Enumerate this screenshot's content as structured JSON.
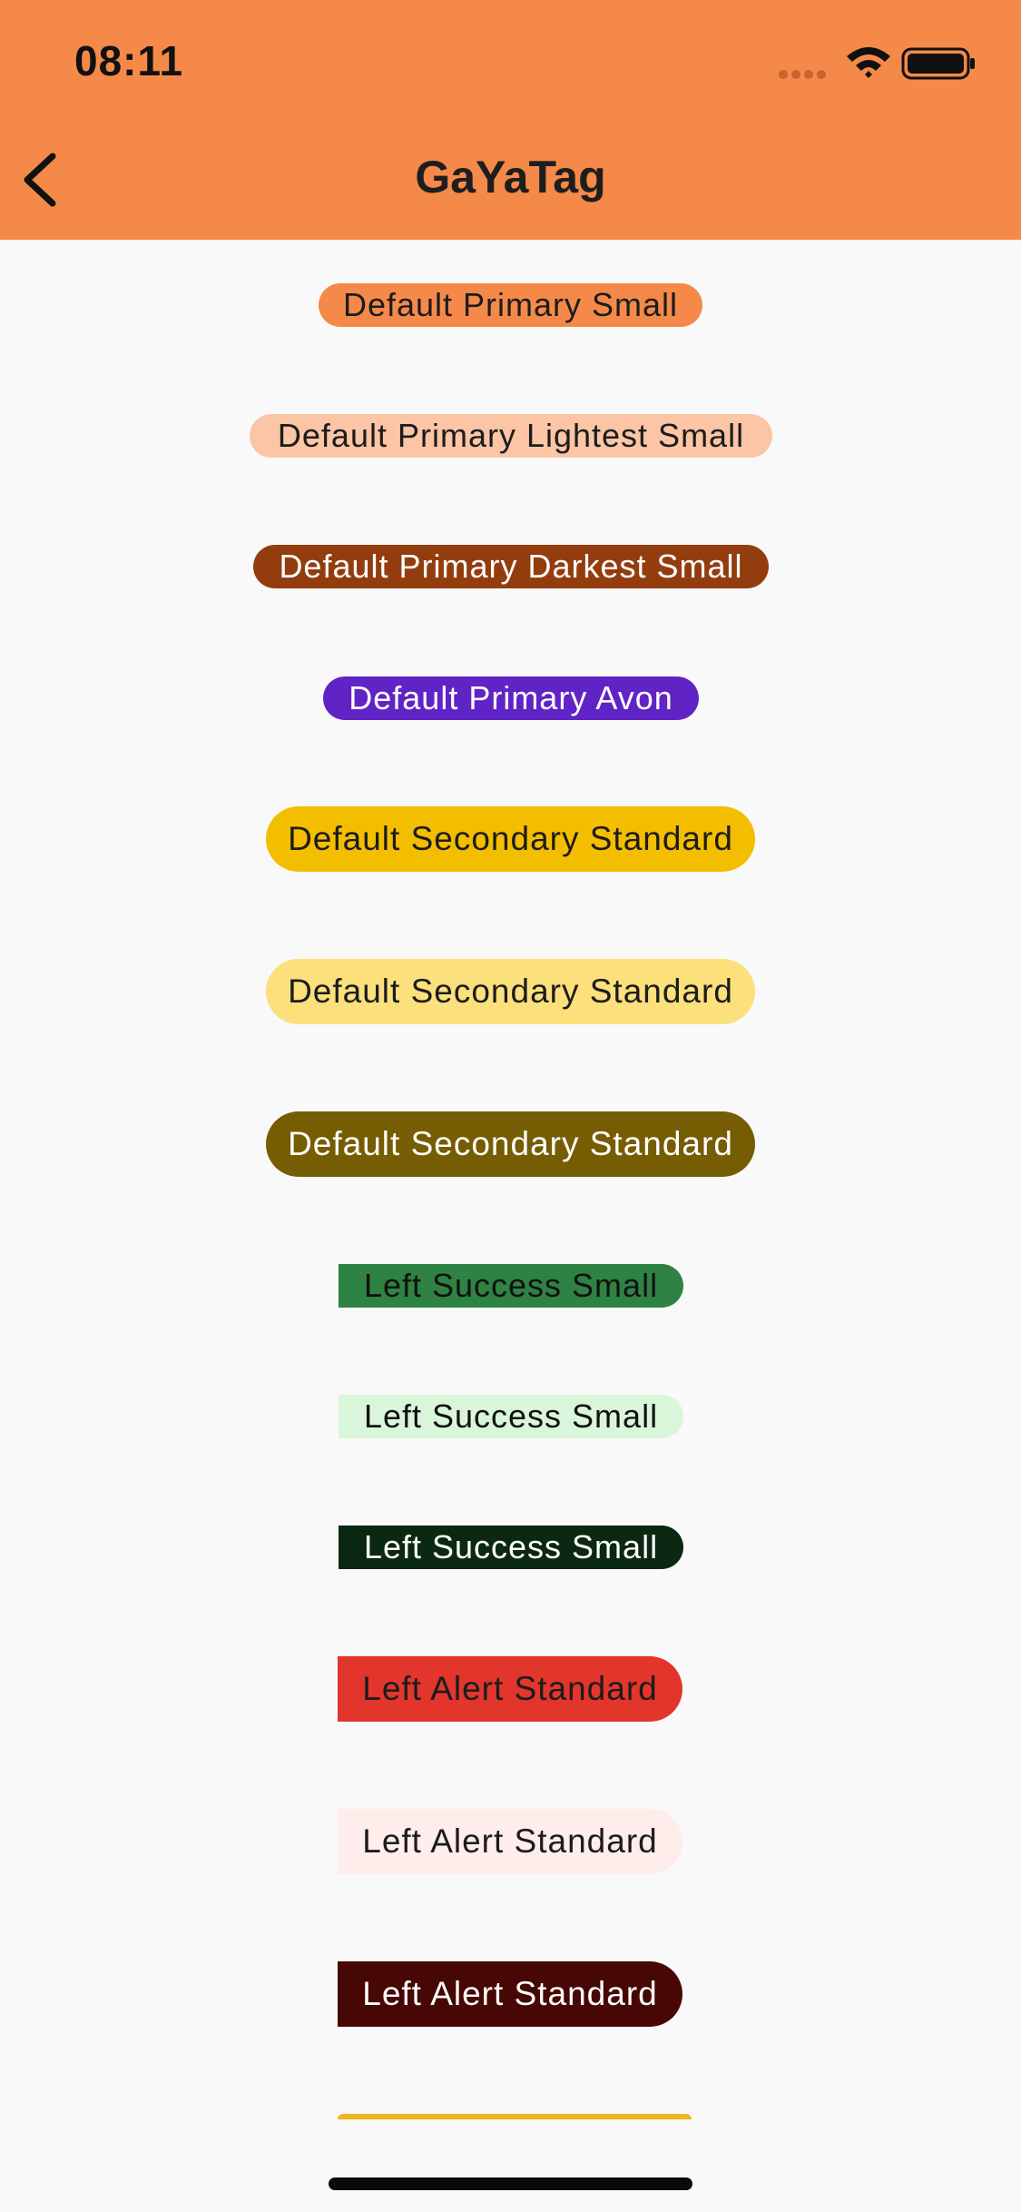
{
  "status_bar": {
    "time": "08:11"
  },
  "header": {
    "title": "GaYaTag",
    "back_icon": "chevron-left-icon"
  },
  "tags": [
    {
      "label": "Default Primary Small",
      "bg": "#F5894A",
      "fg": "#1C1C1C"
    },
    {
      "label": "Default Primary Lightest Small",
      "bg": "#FBC5A6",
      "fg": "#1C1C1C"
    },
    {
      "label": "Default Primary Darkest Small",
      "bg": "#933D0E",
      "fg": "#FFFFFF"
    },
    {
      "label": "Default Primary Avon",
      "bg": "#6023C5",
      "fg": "#FFFFFF"
    },
    {
      "label": "Default Secondary Standard",
      "bg": "#F4BE00",
      "fg": "#1C1C1C"
    },
    {
      "label": "Default Secondary Standard",
      "bg": "#FBE07C",
      "fg": "#1C1C1C"
    },
    {
      "label": "Default Secondary Standard",
      "bg": "#765C02",
      "fg": "#FFFFFF"
    },
    {
      "label": "Left Success Small",
      "bg": "#2E8244",
      "fg": "#111111"
    },
    {
      "label": "Left Success Small",
      "bg": "#DAF6DA",
      "fg": "#111111"
    },
    {
      "label": "Left Success Small",
      "bg": "#0B2812",
      "fg": "#FFFFFF"
    },
    {
      "label": "Left Alert Standard",
      "bg": "#E2352C",
      "fg": "#1C1C1C"
    },
    {
      "label": "Left Alert Standard",
      "bg": "#FEEDEA",
      "fg": "#1C1C1C"
    },
    {
      "label": "Left Alert Standard",
      "bg": "#460705",
      "fg": "#FFFFFF"
    }
  ],
  "colors": {
    "header_bg": "#F5894A",
    "page_bg": "#F9F9F9"
  }
}
